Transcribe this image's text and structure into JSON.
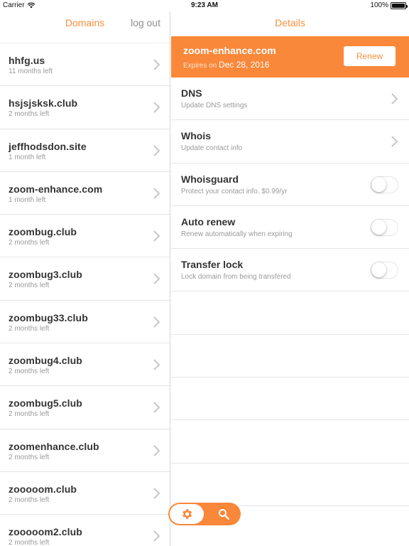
{
  "status": {
    "carrier": "Carrier",
    "time": "9:23 AM",
    "battery": "100%",
    "battery_level": 1.0
  },
  "left": {
    "title": "Domains",
    "logout_label": "log out",
    "domains": [
      {
        "name": "hhfg.us",
        "remaining": "11 months left"
      },
      {
        "name": "hsjsjsksk.club",
        "remaining": "2 months left"
      },
      {
        "name": "jeffhodsdon.site",
        "remaining": "1 month left"
      },
      {
        "name": "zoom-enhance.com",
        "remaining": "1 month left"
      },
      {
        "name": "zoombug.club",
        "remaining": "2 months left"
      },
      {
        "name": "zoombug3.club",
        "remaining": "2 months left"
      },
      {
        "name": "zoombug33.club",
        "remaining": "2 months left"
      },
      {
        "name": "zoombug4.club",
        "remaining": "2 months left"
      },
      {
        "name": "zoombug5.club",
        "remaining": "2 months left"
      },
      {
        "name": "zoomenhance.club",
        "remaining": "2 months left"
      },
      {
        "name": "zooooom.club",
        "remaining": "2 months left"
      },
      {
        "name": "zooooom2.club",
        "remaining": "2 months left"
      }
    ]
  },
  "right": {
    "title": "Details",
    "banner": {
      "domain": "zoom-enhance.com",
      "expires_prefix": "Expires on",
      "expires_date": "Dec 28, 2016",
      "renew_label": "Renew"
    },
    "settings": [
      {
        "title": "DNS",
        "subtitle": "Update DNS settings",
        "control": "chevron"
      },
      {
        "title": "Whois",
        "subtitle": "Update contact info",
        "control": "chevron"
      },
      {
        "title": "Whoisguard",
        "subtitle": "Protect your contact info. $0.99/yr",
        "control": "toggle",
        "on": false
      },
      {
        "title": "Auto renew",
        "subtitle": "Renew automatically when expiring",
        "control": "toggle",
        "on": false
      },
      {
        "title": "Transfer lock",
        "subtitle": "Lock domain from being transfered",
        "control": "toggle",
        "on": false
      }
    ]
  },
  "tabbar": {
    "items": [
      {
        "icon": "gear-icon",
        "active": true
      },
      {
        "icon": "search-icon",
        "active": false
      }
    ]
  },
  "colors": {
    "accent": "#f9883a",
    "accent_text": "#f7903e",
    "muted": "#9a9a9a"
  }
}
